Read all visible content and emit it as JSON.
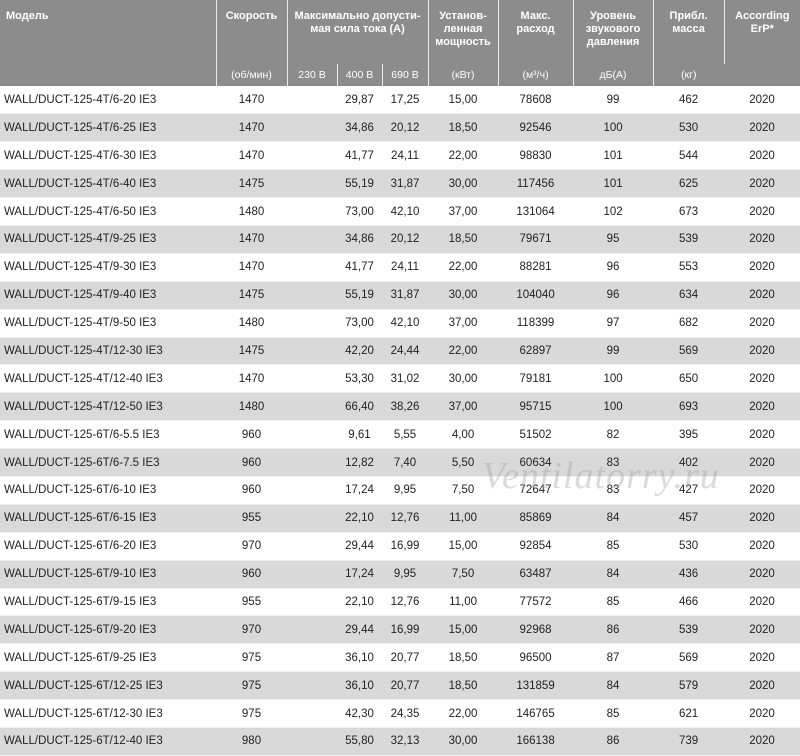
{
  "header": {
    "model": "Модель",
    "speed": "Скорость",
    "current": "Максимально допусти-мая сила тока (А)",
    "power": "Установ-ленная мощность",
    "flow": "Макс. расход",
    "noise": "Уровень звукового давления",
    "mass": "Прибл. масса",
    "erp": "According ErP*",
    "units": {
      "speed": "(об/мин)",
      "v230": "230 В",
      "v400": "400 В",
      "v690": "690 В",
      "power": "(кВт)",
      "flow": "(м³/ч)",
      "noise": "дБ(А)",
      "mass": "(кг)"
    }
  },
  "rows": [
    {
      "model": "WALL/DUCT-125-4T/6-20 IE3",
      "speed": "1470",
      "v230": "",
      "v400": "29,87",
      "v690": "17,25",
      "power": "15,00",
      "flow": "78608",
      "noise": "99",
      "mass": "462",
      "erp": "2020"
    },
    {
      "model": "WALL/DUCT-125-4T/6-25 IE3",
      "speed": "1470",
      "v230": "",
      "v400": "34,86",
      "v690": "20,12",
      "power": "18,50",
      "flow": "92546",
      "noise": "100",
      "mass": "530",
      "erp": "2020"
    },
    {
      "model": "WALL/DUCT-125-4T/6-30 IE3",
      "speed": "1470",
      "v230": "",
      "v400": "41,77",
      "v690": "24,11",
      "power": "22,00",
      "flow": "98830",
      "noise": "101",
      "mass": "544",
      "erp": "2020"
    },
    {
      "model": "WALL/DUCT-125-4T/6-40 IE3",
      "speed": "1475",
      "v230": "",
      "v400": "55,19",
      "v690": "31,87",
      "power": "30,00",
      "flow": "117456",
      "noise": "101",
      "mass": "625",
      "erp": "2020"
    },
    {
      "model": "WALL/DUCT-125-4T/6-50 IE3",
      "speed": "1480",
      "v230": "",
      "v400": "73,00",
      "v690": "42,10",
      "power": "37,00",
      "flow": "131064",
      "noise": "102",
      "mass": "673",
      "erp": "2020"
    },
    {
      "model": "WALL/DUCT-125-4T/9-25 IE3",
      "speed": "1470",
      "v230": "",
      "v400": "34,86",
      "v690": "20,12",
      "power": "18,50",
      "flow": "79671",
      "noise": "95",
      "mass": "539",
      "erp": "2020"
    },
    {
      "model": "WALL/DUCT-125-4T/9-30 IE3",
      "speed": "1470",
      "v230": "",
      "v400": "41,77",
      "v690": "24,11",
      "power": "22,00",
      "flow": "88281",
      "noise": "96",
      "mass": "553",
      "erp": "2020"
    },
    {
      "model": "WALL/DUCT-125-4T/9-40 IE3",
      "speed": "1475",
      "v230": "",
      "v400": "55,19",
      "v690": "31,87",
      "power": "30,00",
      "flow": "104040",
      "noise": "96",
      "mass": "634",
      "erp": "2020"
    },
    {
      "model": "WALL/DUCT-125-4T/9-50 IE3",
      "speed": "1480",
      "v230": "",
      "v400": "73,00",
      "v690": "42,10",
      "power": "37,00",
      "flow": "118399",
      "noise": "97",
      "mass": "682",
      "erp": "2020"
    },
    {
      "model": "WALL/DUCT-125-4T/12-30 IE3",
      "speed": "1475",
      "v230": "",
      "v400": "42,20",
      "v690": "24,44",
      "power": "22,00",
      "flow": "62897",
      "noise": "99",
      "mass": "569",
      "erp": "2020"
    },
    {
      "model": "WALL/DUCT-125-4T/12-40 IE3",
      "speed": "1470",
      "v230": "",
      "v400": "53,30",
      "v690": "31,02",
      "power": "30,00",
      "flow": "79181",
      "noise": "100",
      "mass": "650",
      "erp": "2020"
    },
    {
      "model": "WALL/DUCT-125-4T/12-50 IE3",
      "speed": "1480",
      "v230": "",
      "v400": "66,40",
      "v690": "38,26",
      "power": "37,00",
      "flow": "95715",
      "noise": "100",
      "mass": "693",
      "erp": "2020"
    },
    {
      "model": "WALL/DUCT-125-6T/6-5.5 IE3",
      "speed": "960",
      "v230": "",
      "v400": "9,61",
      "v690": "5,55",
      "power": "4,00",
      "flow": "51502",
      "noise": "82",
      "mass": "395",
      "erp": "2020"
    },
    {
      "model": "WALL/DUCT-125-6T/6-7.5 IE3",
      "speed": "960",
      "v230": "",
      "v400": "12,82",
      "v690": "7,40",
      "power": "5,50",
      "flow": "60634",
      "noise": "83",
      "mass": "402",
      "erp": "2020"
    },
    {
      "model": "WALL/DUCT-125-6T/6-10 IE3",
      "speed": "960",
      "v230": "",
      "v400": "17,24",
      "v690": "9,95",
      "power": "7,50",
      "flow": "72647",
      "noise": "83",
      "mass": "427",
      "erp": "2020"
    },
    {
      "model": "WALL/DUCT-125-6T/6-15 IE3",
      "speed": "955",
      "v230": "",
      "v400": "22,10",
      "v690": "12,76",
      "power": "11,00",
      "flow": "85869",
      "noise": "84",
      "mass": "457",
      "erp": "2020"
    },
    {
      "model": "WALL/DUCT-125-6T/6-20 IE3",
      "speed": "970",
      "v230": "",
      "v400": "29,44",
      "v690": "16,99",
      "power": "15,00",
      "flow": "92854",
      "noise": "85",
      "mass": "530",
      "erp": "2020"
    },
    {
      "model": "WALL/DUCT-125-6T/9-10 IE3",
      "speed": "960",
      "v230": "",
      "v400": "17,24",
      "v690": "9,95",
      "power": "7,50",
      "flow": "63487",
      "noise": "84",
      "mass": "436",
      "erp": "2020"
    },
    {
      "model": "WALL/DUCT-125-6T/9-15 IE3",
      "speed": "955",
      "v230": "",
      "v400": "22,10",
      "v690": "12,76",
      "power": "11,00",
      "flow": "77572",
      "noise": "85",
      "mass": "466",
      "erp": "2020"
    },
    {
      "model": "WALL/DUCT-125-6T/9-20 IE3",
      "speed": "970",
      "v230": "",
      "v400": "29,44",
      "v690": "16,99",
      "power": "15,00",
      "flow": "92968",
      "noise": "86",
      "mass": "539",
      "erp": "2020"
    },
    {
      "model": "WALL/DUCT-125-6T/9-25 IE3",
      "speed": "975",
      "v230": "",
      "v400": "36,10",
      "v690": "20,77",
      "power": "18,50",
      "flow": "96500",
      "noise": "87",
      "mass": "569",
      "erp": "2020"
    },
    {
      "model": "WALL/DUCT-125-6T/12-25 IE3",
      "speed": "975",
      "v230": "",
      "v400": "36,10",
      "v690": "20,77",
      "power": "18,50",
      "flow": "131859",
      "noise": "84",
      "mass": "579",
      "erp": "2020"
    },
    {
      "model": "WALL/DUCT-125-6T/12-30 IE3",
      "speed": "975",
      "v230": "",
      "v400": "42,30",
      "v690": "24,35",
      "power": "22,00",
      "flow": "146765",
      "noise": "85",
      "mass": "621",
      "erp": "2020"
    },
    {
      "model": "WALL/DUCT-125-6T/12-40 IE3",
      "speed": "980",
      "v230": "",
      "v400": "55,80",
      "v690": "32,13",
      "power": "30,00",
      "flow": "166138",
      "noise": "86",
      "mass": "739",
      "erp": "2020"
    }
  ],
  "watermark": "Ventilatorry.ru"
}
